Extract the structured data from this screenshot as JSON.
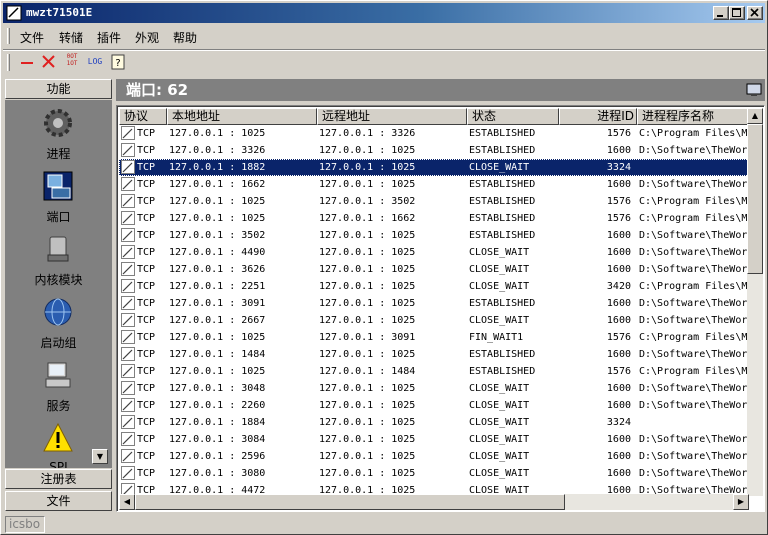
{
  "window": {
    "title": "mwzt71501E",
    "brand_color": "#0a246a"
  },
  "menu": [
    "文件",
    "转储",
    "插件",
    "外观",
    "帮助"
  ],
  "toolbar": {
    "items": [
      "minus-icon",
      "close-x-icon",
      "hex-binary-icon",
      "log-icon",
      "help-icon"
    ],
    "log_label": "LOG",
    "hex_label_top": "0OT",
    "hex_label_bottom": "1OT"
  },
  "sidebar": {
    "header": "功能",
    "items": [
      {
        "label": "进程",
        "icon": "gear-icon"
      },
      {
        "label": "端口",
        "icon": "port-monitor-icon"
      },
      {
        "label": "内核模块",
        "icon": "kernel-module-icon"
      },
      {
        "label": "启动组",
        "icon": "startup-globe-icon"
      },
      {
        "label": "服务",
        "icon": "service-computer-icon"
      },
      {
        "label": "SPI",
        "icon": "warning-icon"
      }
    ],
    "footer_sections": [
      "注册表",
      "文件"
    ]
  },
  "main": {
    "header": "端口: 62",
    "columns": [
      "协议",
      "本地地址",
      "远程地址",
      "状态",
      "进程ID",
      "进程程序名称"
    ],
    "rows": [
      [
        "TCP",
        "127.0.0.1 : 1025",
        "127.0.0.1 : 3326",
        "ESTABLISHED",
        "1576",
        "C:\\Program Files\\M"
      ],
      [
        "TCP",
        "127.0.0.1 : 3326",
        "127.0.0.1 : 1025",
        "ESTABLISHED",
        "1600",
        "D:\\Software\\TheWor"
      ],
      [
        "TCP",
        "127.0.0.1 : 1882",
        "127.0.0.1 : 1025",
        "CLOSE_WAIT",
        "3324",
        ""
      ],
      [
        "TCP",
        "127.0.0.1 : 1662",
        "127.0.0.1 : 1025",
        "ESTABLISHED",
        "1600",
        "D:\\Software\\TheWor"
      ],
      [
        "TCP",
        "127.0.0.1 : 1025",
        "127.0.0.1 : 3502",
        "ESTABLISHED",
        "1576",
        "C:\\Program Files\\M"
      ],
      [
        "TCP",
        "127.0.0.1 : 1025",
        "127.0.0.1 : 1662",
        "ESTABLISHED",
        "1576",
        "C:\\Program Files\\M"
      ],
      [
        "TCP",
        "127.0.0.1 : 3502",
        "127.0.0.1 : 1025",
        "ESTABLISHED",
        "1600",
        "D:\\Software\\TheWor"
      ],
      [
        "TCP",
        "127.0.0.1 : 4490",
        "127.0.0.1 : 1025",
        "CLOSE_WAIT",
        "1600",
        "D:\\Software\\TheWor"
      ],
      [
        "TCP",
        "127.0.0.1 : 3626",
        "127.0.0.1 : 1025",
        "CLOSE_WAIT",
        "1600",
        "D:\\Software\\TheWor"
      ],
      [
        "TCP",
        "127.0.0.1 : 2251",
        "127.0.0.1 : 1025",
        "CLOSE_WAIT",
        "3420",
        "C:\\Program Files\\M"
      ],
      [
        "TCP",
        "127.0.0.1 : 3091",
        "127.0.0.1 : 1025",
        "ESTABLISHED",
        "1600",
        "D:\\Software\\TheWor"
      ],
      [
        "TCP",
        "127.0.0.1 : 2667",
        "127.0.0.1 : 1025",
        "CLOSE_WAIT",
        "1600",
        "D:\\Software\\TheWor"
      ],
      [
        "TCP",
        "127.0.0.1 : 1025",
        "127.0.0.1 : 3091",
        "FIN_WAIT1",
        "1576",
        "C:\\Program Files\\M"
      ],
      [
        "TCP",
        "127.0.0.1 : 1484",
        "127.0.0.1 : 1025",
        "ESTABLISHED",
        "1600",
        "D:\\Software\\TheWor"
      ],
      [
        "TCP",
        "127.0.0.1 : 1025",
        "127.0.0.1 : 1484",
        "ESTABLISHED",
        "1576",
        "C:\\Program Files\\M"
      ],
      [
        "TCP",
        "127.0.0.1 : 3048",
        "127.0.0.1 : 1025",
        "CLOSE_WAIT",
        "1600",
        "D:\\Software\\TheWor"
      ],
      [
        "TCP",
        "127.0.0.1 : 2260",
        "127.0.0.1 : 1025",
        "CLOSE_WAIT",
        "1600",
        "D:\\Software\\TheWor"
      ],
      [
        "TCP",
        "127.0.0.1 : 1884",
        "127.0.0.1 : 1025",
        "CLOSE_WAIT",
        "3324",
        ""
      ],
      [
        "TCP",
        "127.0.0.1 : 3084",
        "127.0.0.1 : 1025",
        "CLOSE_WAIT",
        "1600",
        "D:\\Software\\TheWor"
      ],
      [
        "TCP",
        "127.0.0.1 : 2596",
        "127.0.0.1 : 1025",
        "CLOSE_WAIT",
        "1600",
        "D:\\Software\\TheWor"
      ],
      [
        "TCP",
        "127.0.0.1 : 3080",
        "127.0.0.1 : 1025",
        "CLOSE_WAIT",
        "1600",
        "D:\\Software\\TheWor"
      ],
      [
        "TCP",
        "127.0.0.1 : 4472",
        "127.0.0.1 : 1025",
        "CLOSE_WAIT",
        "1600",
        "D:\\Software\\TheWor"
      ]
    ],
    "selected_row": 2,
    "selection_color": "#0a246a"
  },
  "status": {
    "text": "icsbo"
  }
}
